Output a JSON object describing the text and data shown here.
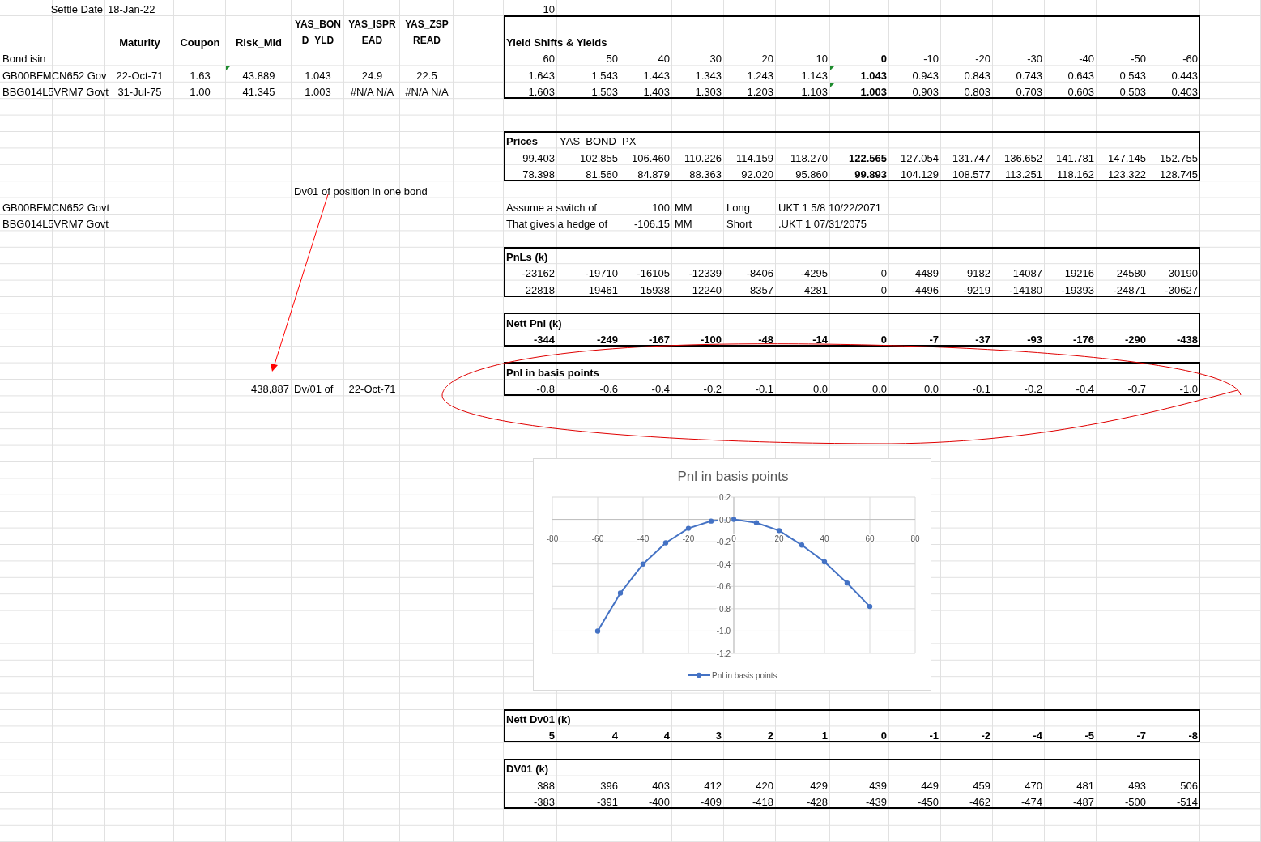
{
  "settle": {
    "label": "Settle Date",
    "value": "18-Jan-22"
  },
  "shift_step": "10",
  "bond_table": {
    "columns": [
      "Maturity",
      "Coupon",
      "Risk_Mid",
      "YAS_BOND_YLD",
      "YAS_ISPREAD",
      "YAS_ZSPREAD"
    ],
    "row_header": "Bond isin",
    "bonds": [
      {
        "isin": "GB00BFMCN652 Gov",
        "maturity": "22-Oct-71",
        "coupon": "1.63",
        "risk_mid": "43.889",
        "yield": "1.043",
        "ispread": "24.9",
        "zspread": "22.5",
        "risk_flag": true
      },
      {
        "isin": "BBG014L5VRM7 Govt",
        "maturity": "31-Jul-75",
        "coupon": "1.00",
        "risk_mid": "41.345",
        "yield": "1.003",
        "ispread": "#N/A N/A",
        "zspread": "#N/A N/A",
        "risk_flag": false
      }
    ]
  },
  "yield_shifts": {
    "title": "Yield Shifts & Yields",
    "shifts": [
      {
        "label": "60",
        "highlighted": false
      },
      {
        "label": "50",
        "highlighted": false
      },
      {
        "label": "40",
        "highlighted": false
      },
      {
        "label": "30",
        "highlighted": false
      },
      {
        "label": "20",
        "highlighted": false
      },
      {
        "label": "10",
        "highlighted": false
      },
      {
        "label": "0",
        "highlighted": true
      },
      {
        "label": "-10",
        "highlighted": false
      },
      {
        "label": "-20",
        "highlighted": false
      },
      {
        "label": "-30",
        "highlighted": false
      },
      {
        "label": "-40",
        "highlighted": false
      },
      {
        "label": "-50",
        "highlighted": false
      },
      {
        "label": "-60",
        "highlighted": false
      }
    ],
    "rows": [
      {
        "flag": true,
        "values": [
          "1.643",
          "1.543",
          "1.443",
          "1.343",
          "1.243",
          "1.143",
          "1.043",
          "0.943",
          "0.843",
          "0.743",
          "0.643",
          "0.543",
          "0.443"
        ]
      },
      {
        "flag": true,
        "values": [
          "1.603",
          "1.503",
          "1.403",
          "1.303",
          "1.203",
          "1.103",
          "1.003",
          "0.903",
          "0.803",
          "0.703",
          "0.603",
          "0.503",
          "0.403"
        ]
      }
    ]
  },
  "prices": {
    "title": "Prices",
    "field": "YAS_BOND_PX",
    "rows": [
      [
        "99.403",
        "102.855",
        "106.460",
        "110.226",
        "114.159",
        "118.270",
        "122.565",
        "127.054",
        "131.747",
        "136.652",
        "141.781",
        "147.145",
        "152.755"
      ],
      [
        "78.398",
        "81.560",
        "84.879",
        "88.363",
        "92.020",
        "95.860",
        "99.893",
        "104.129",
        "108.577",
        "113.251",
        "118.162",
        "123.322",
        "128.745"
      ]
    ]
  },
  "note": "Dv01 of position in one bond",
  "hedge_bonds": [
    "GB00BFMCN652 Govt",
    "BBG014L5VRM7 Govt"
  ],
  "switch": [
    {
      "label": "Assume a switch of",
      "amount": "100",
      "unit": "MM",
      "side": "Long",
      "bond": "UKT 1 5/8 10/22/2071"
    },
    {
      "label": "That gives a hedge of",
      "amount": "-106.15",
      "unit": "MM",
      "side": "Short",
      "bond": ".UKT 1 07/31/2075"
    }
  ],
  "pnls": {
    "title": "PnLs (k)",
    "rows": [
      [
        "-23162",
        "-19710",
        "-16105",
        "-12339",
        "-8406",
        "-4295",
        "0",
        "4489",
        "9182",
        "14087",
        "19216",
        "24580",
        "30190"
      ],
      [
        "22818",
        "19461",
        "15938",
        "12240",
        "8357",
        "4281",
        "0",
        "-4496",
        "-9219",
        "-14180",
        "-19393",
        "-24871",
        "-30627"
      ]
    ]
  },
  "nett_pnl": {
    "title": "Nett Pnl (k)",
    "values": [
      "-344",
      "-249",
      "-167",
      "-100",
      "-48",
      "-14",
      "0",
      "-7",
      "-37",
      "-93",
      "-176",
      "-290",
      "-438"
    ]
  },
  "dv01_line": {
    "value": "438,887",
    "label": "Dv/01 of",
    "date": "22-Oct-71"
  },
  "pnl_bp": {
    "title": "Pnl in basis points",
    "values": [
      "-0.8",
      "-0.6",
      "-0.4",
      "-0.2",
      "-0.1",
      "0.0",
      "0.0",
      "0.0",
      "-0.1",
      "-0.2",
      "-0.4",
      "-0.7",
      "-1.0"
    ]
  },
  "chart": {
    "chart_data": {
      "type": "line",
      "grid": true,
      "marker": true,
      "title": "Pnl in basis points",
      "x": [
        -60,
        -50,
        -40,
        -30,
        -20,
        -10,
        0,
        10,
        20,
        30,
        40,
        50,
        60
      ],
      "series": [
        {
          "name": "Pnl in basis points",
          "color": "#4472c4",
          "values": [
            -1.0,
            -0.66,
            -0.4,
            -0.21,
            -0.08,
            -0.015,
            0,
            -0.03,
            -0.1,
            -0.23,
            -0.38,
            -0.57,
            -0.78
          ]
        }
      ],
      "xlim": [
        -80,
        80
      ],
      "ylim": [
        -1.2,
        0.2
      ],
      "xticks": [
        -80,
        -60,
        -40,
        -20,
        0,
        20,
        40,
        60,
        80
      ],
      "yticks": [
        {
          "value": 0.2,
          "label": "0.2"
        },
        {
          "value": 0,
          "label": "0.0"
        },
        {
          "value": -0.2,
          "label": "-0.2"
        },
        {
          "value": -0.4,
          "label": "-0.4"
        },
        {
          "value": -0.6,
          "label": "-0.6"
        },
        {
          "value": -0.8,
          "label": "-0.8"
        },
        {
          "value": -1.0,
          "label": "-1.0"
        },
        {
          "value": -1.2,
          "label": "-1.2"
        }
      ]
    }
  },
  "nett_dv01": {
    "title": "Nett Dv01 (k)",
    "values": [
      "5",
      "4",
      "4",
      "3",
      "2",
      "1",
      "0",
      "-1",
      "-2",
      "-4",
      "-5",
      "-7",
      "-8"
    ]
  },
  "dv01": {
    "title": "DV01 (k)",
    "rows": [
      [
        "388",
        "396",
        "403",
        "412",
        "420",
        "429",
        "439",
        "449",
        "459",
        "470",
        "481",
        "493",
        "506"
      ],
      [
        "-383",
        "-391",
        "-400",
        "-409",
        "-418",
        "-428",
        "-439",
        "-450",
        "-462",
        "-474",
        "-487",
        "-500",
        "-514"
      ]
    ]
  }
}
